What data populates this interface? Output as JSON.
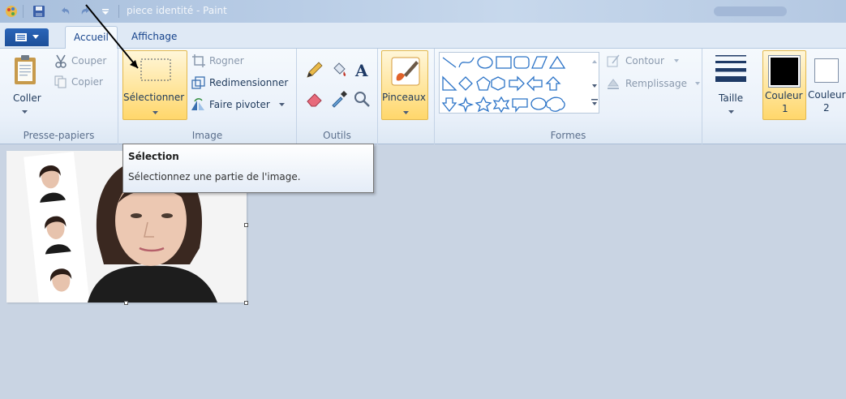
{
  "window": {
    "title": "piece identité - Paint"
  },
  "tabs": [
    {
      "label": "Accueil",
      "active": true
    },
    {
      "label": "Affichage",
      "active": false
    }
  ],
  "clipboard": {
    "paste": "Coller",
    "cut": "Couper",
    "copy": "Copier",
    "group_label": "Presse-papiers"
  },
  "image": {
    "select": "Sélectionner",
    "crop": "Rogner",
    "resize": "Redimensionner",
    "rotate": "Faire pivoter",
    "group_label": "Image"
  },
  "tools": {
    "group_label": "Outils",
    "items": [
      "pencil-icon",
      "fill-bucket-icon",
      "text-icon",
      "eraser-icon",
      "color-picker-icon",
      "magnifier-icon"
    ]
  },
  "brushes": {
    "label": "Pinceaux"
  },
  "shapes": {
    "outline": "Contour",
    "fill": "Remplissage",
    "group_label": "Formes"
  },
  "size": {
    "label": "Taille"
  },
  "colors": {
    "color1_label": "Couleur",
    "color1_num": "1",
    "color2_label": "Couleur",
    "color2_num": "2",
    "color1_value": "#000000",
    "color2_value": "#ffffff",
    "accent": "#ffd76b"
  },
  "tooltip": {
    "title": "Sélection",
    "body": "Sélectionnez une partie de l'image."
  }
}
